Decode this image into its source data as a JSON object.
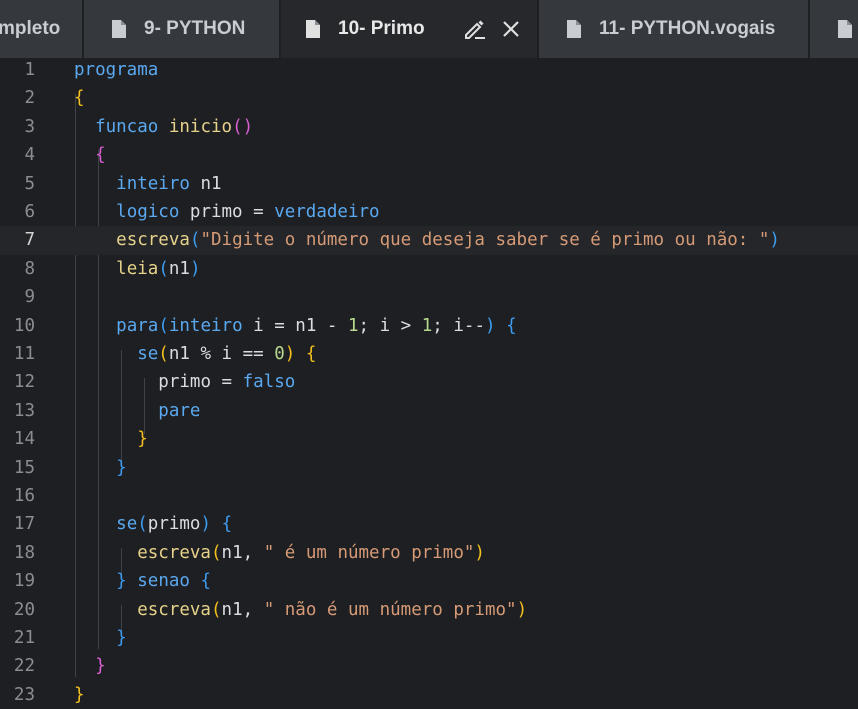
{
  "tabs": [
    {
      "label": "mpleto",
      "active": false
    },
    {
      "label": "9- PYTHON",
      "active": false
    },
    {
      "label": "10- Primo",
      "active": true
    },
    {
      "label": "11- PYTHON.vogais",
      "active": false
    }
  ],
  "editor": {
    "current_line": 7,
    "lines": [
      {
        "n": "1",
        "tokens": [
          [
            "kw",
            "programa"
          ]
        ]
      },
      {
        "n": "2",
        "tokens": [
          [
            "br1",
            "{"
          ]
        ]
      },
      {
        "n": "3",
        "tokens": [
          [
            "ws",
            "  "
          ],
          [
            "kw",
            "funcao"
          ],
          [
            "id",
            " "
          ],
          [
            "fn",
            "inicio"
          ],
          [
            "br2",
            "()"
          ]
        ]
      },
      {
        "n": "4",
        "tokens": [
          [
            "ws",
            "  "
          ],
          [
            "br2",
            "{"
          ]
        ]
      },
      {
        "n": "5",
        "tokens": [
          [
            "ws",
            "    "
          ],
          [
            "kw",
            "inteiro"
          ],
          [
            "id",
            " n1"
          ]
        ]
      },
      {
        "n": "6",
        "tokens": [
          [
            "ws",
            "    "
          ],
          [
            "kw",
            "logico"
          ],
          [
            "id",
            " primo = "
          ],
          [
            "kw",
            "verdadeiro"
          ]
        ]
      },
      {
        "n": "7",
        "tokens": [
          [
            "ws",
            "    "
          ],
          [
            "fn",
            "escreva"
          ],
          [
            "br3",
            "("
          ],
          [
            "str",
            "\"Digite o número que deseja saber se é primo ou não: \""
          ],
          [
            "br3",
            ")"
          ]
        ]
      },
      {
        "n": "8",
        "tokens": [
          [
            "ws",
            "    "
          ],
          [
            "fn",
            "leia"
          ],
          [
            "br3",
            "("
          ],
          [
            "id",
            "n1"
          ],
          [
            "br3",
            ")"
          ]
        ]
      },
      {
        "n": "9",
        "tokens": []
      },
      {
        "n": "10",
        "tokens": [
          [
            "ws",
            "    "
          ],
          [
            "kw",
            "para"
          ],
          [
            "br3",
            "("
          ],
          [
            "kw",
            "inteiro"
          ],
          [
            "id",
            " i = n1 - "
          ],
          [
            "num",
            "1"
          ],
          [
            "id",
            "; i > "
          ],
          [
            "num",
            "1"
          ],
          [
            "id",
            "; i--"
          ],
          [
            "br3",
            ")"
          ],
          [
            "id",
            " "
          ],
          [
            "br3",
            "{"
          ]
        ]
      },
      {
        "n": "11",
        "tokens": [
          [
            "ws",
            "      "
          ],
          [
            "kw",
            "se"
          ],
          [
            "br1",
            "("
          ],
          [
            "id",
            "n1 % i == "
          ],
          [
            "num",
            "0"
          ],
          [
            "br1",
            ")"
          ],
          [
            "id",
            " "
          ],
          [
            "br1",
            "{"
          ]
        ]
      },
      {
        "n": "12",
        "tokens": [
          [
            "ws",
            "        "
          ],
          [
            "id",
            "primo = "
          ],
          [
            "kw",
            "falso"
          ]
        ]
      },
      {
        "n": "13",
        "tokens": [
          [
            "ws",
            "        "
          ],
          [
            "kw",
            "pare"
          ]
        ]
      },
      {
        "n": "14",
        "tokens": [
          [
            "ws",
            "      "
          ],
          [
            "br1",
            "}"
          ]
        ]
      },
      {
        "n": "15",
        "tokens": [
          [
            "ws",
            "    "
          ],
          [
            "br3",
            "}"
          ]
        ]
      },
      {
        "n": "16",
        "tokens": []
      },
      {
        "n": "17",
        "tokens": [
          [
            "ws",
            "    "
          ],
          [
            "kw",
            "se"
          ],
          [
            "br3",
            "("
          ],
          [
            "id",
            "primo"
          ],
          [
            "br3",
            ")"
          ],
          [
            "id",
            " "
          ],
          [
            "br3",
            "{"
          ]
        ]
      },
      {
        "n": "18",
        "tokens": [
          [
            "ws",
            "      "
          ],
          [
            "fn",
            "escreva"
          ],
          [
            "br1",
            "("
          ],
          [
            "id",
            "n1, "
          ],
          [
            "str",
            "\" é um número primo\""
          ],
          [
            "br1",
            ")"
          ]
        ]
      },
      {
        "n": "19",
        "tokens": [
          [
            "ws",
            "    "
          ],
          [
            "br3",
            "}"
          ],
          [
            "id",
            " "
          ],
          [
            "kw",
            "senao"
          ],
          [
            "id",
            " "
          ],
          [
            "br3",
            "{"
          ]
        ]
      },
      {
        "n": "20",
        "tokens": [
          [
            "ws",
            "      "
          ],
          [
            "fn",
            "escreva"
          ],
          [
            "br1",
            "("
          ],
          [
            "id",
            "n1, "
          ],
          [
            "str",
            "\" não é um número primo\""
          ],
          [
            "br1",
            ")"
          ]
        ]
      },
      {
        "n": "21",
        "tokens": [
          [
            "ws",
            "    "
          ],
          [
            "br3",
            "}"
          ]
        ]
      },
      {
        "n": "22",
        "tokens": [
          [
            "ws",
            "  "
          ],
          [
            "br2",
            "}"
          ]
        ]
      },
      {
        "n": "23",
        "tokens": [
          [
            "br1",
            "}"
          ]
        ]
      }
    ]
  }
}
